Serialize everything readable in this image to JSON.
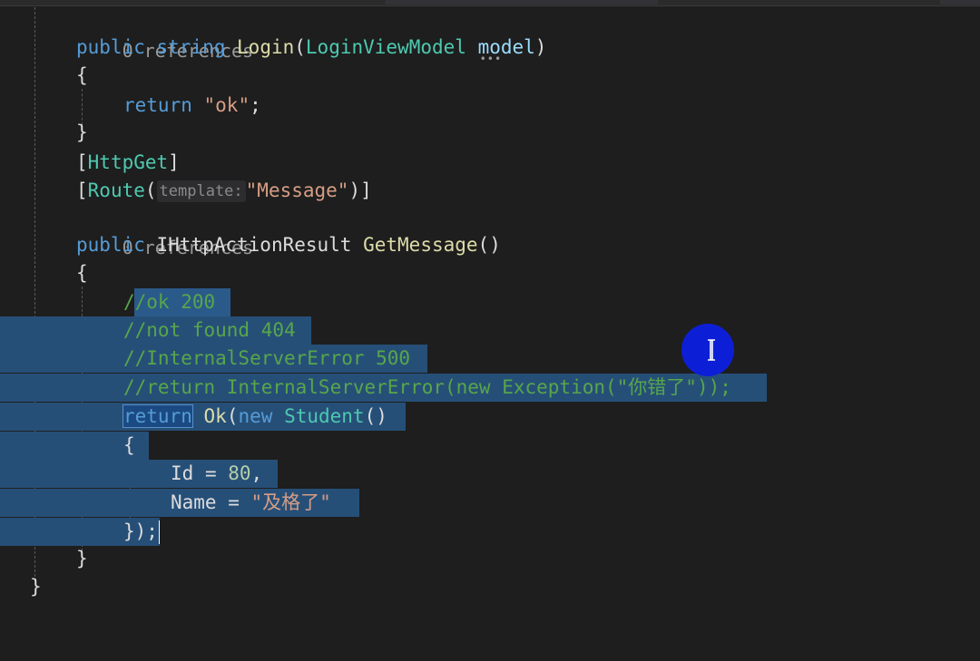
{
  "editor": {
    "codelens": {
      "references_1": "0 references",
      "references_2": "0 references"
    },
    "login_method": {
      "kw_public": "public",
      "kw_string": "string",
      "name": "Login",
      "open_paren": "(",
      "param_type": "LoginViewModel",
      "param_name": "model",
      "close_paren": ")",
      "open_brace": "{",
      "kw_return": "return",
      "return_value": "\"ok\"",
      "semicolon": ";",
      "close_brace": "}"
    },
    "attributes": {
      "httpget_open": "[",
      "httpget_name": "HttpGet",
      "httpget_close": "]",
      "route_open": "[",
      "route_name": "Route",
      "route_paren_open": "(",
      "route_hint": "template:",
      "route_value": "\"Message\"",
      "route_close": ")]"
    },
    "getmessage_method": {
      "kw_public": "public",
      "return_type": "IHttpActionResult",
      "name": "GetMessage",
      "parens": "()",
      "open_brace": "{",
      "comment_1": "//ok 200",
      "comment_2": "//not found 404",
      "comment_3": "//InternalServerError 500",
      "comment_4": "//return InternalServerError(new Exception(\"你错了\"));",
      "kw_return": "return",
      "ok_call": "Ok",
      "ok_paren": "(",
      "kw_new": "new",
      "student_type": "Student",
      "student_parens": "()",
      "init_open": "{",
      "id_prop": "Id",
      "id_assign": " = ",
      "id_value": "80",
      "id_comma": ",",
      "name_prop": "Name",
      "name_assign": " = ",
      "name_value": "\"及格了\"",
      "init_close": "});",
      "close_brace": "}"
    },
    "class_close_brace": "}"
  },
  "colors": {
    "background": "#1e1e1e",
    "selection": "#264f78",
    "keyword": "#569cd6",
    "type": "#4ec9b0",
    "method": "#dcdcaa",
    "string": "#d69d85",
    "comment": "#57a64a",
    "cursor_highlight": "#0d1fd6"
  }
}
